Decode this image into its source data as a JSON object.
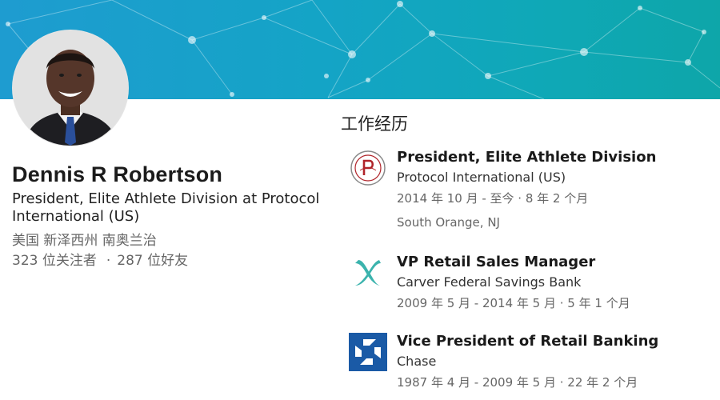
{
  "profile": {
    "name": "Dennis R Robertson",
    "headline": "President, Elite Athlete Division at Protocol International (US)",
    "location": "美国 新泽西州 南奥兰治",
    "followers": "323 位关注者",
    "separator": "·",
    "connections": "287 位好友"
  },
  "experience_section": {
    "title": "工作经历",
    "items": [
      {
        "title": "President, Elite Athlete Division",
        "company": "Protocol International (US)",
        "dates": "2014 年 10 月 - 至今 · 8 年 2 个月",
        "location": "South Orange, NJ",
        "logo_icon": "protocol-seal-icon"
      },
      {
        "title": "VP Retail Sales Manager",
        "company": "Carver Federal Savings Bank",
        "dates": "2009 年 5 月 - 2014 年 5 月 · 5 年 1 个月",
        "logo_icon": "carver-x-icon"
      },
      {
        "title": "Vice President of Retail Banking",
        "company": "Chase",
        "dates": "1987 年 4 月 - 2009 年 5 月 · 22 年 2 个月",
        "logo_icon": "chase-octagon-icon"
      }
    ]
  },
  "colors": {
    "banner_start": "#1e9cd0",
    "banner_end": "#0ea6a9",
    "carver_teal": "#3bb3ad",
    "chase_blue": "#1a5aa6",
    "protocol_red": "#b0242a"
  }
}
